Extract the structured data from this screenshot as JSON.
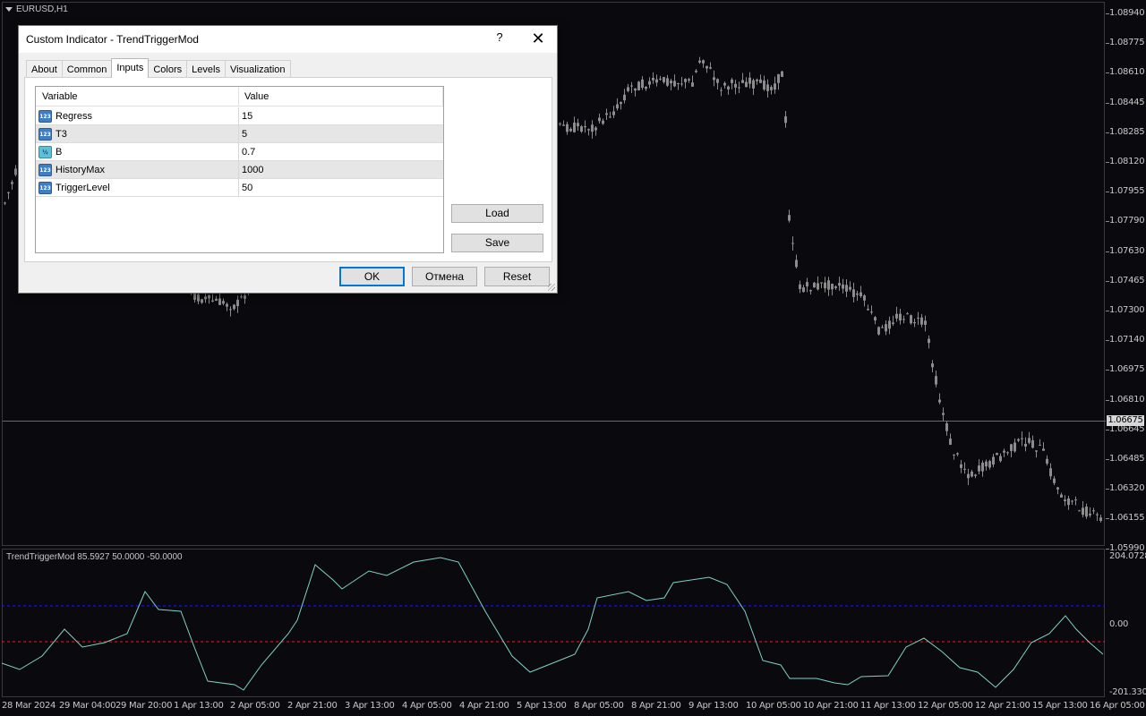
{
  "chart": {
    "symbol": "EURUSD,H1",
    "current_price": "1.06675",
    "price_labels": [
      "1.08940",
      "1.08775",
      "1.08610",
      "1.08445",
      "1.08285",
      "1.08120",
      "1.07955",
      "1.07790",
      "1.07630",
      "1.07465",
      "1.07300",
      "1.07140",
      "1.06975",
      "1.06810",
      "1.06645",
      "1.06485",
      "1.06320",
      "1.06155",
      "1.05990"
    ],
    "time_labels": [
      "28 Mar 2024",
      "29 Mar 04:00",
      "29 Mar 20:00",
      "1 Apr 13:00",
      "2 Apr 05:00",
      "2 Apr 21:00",
      "3 Apr 13:00",
      "4 Apr 05:00",
      "4 Apr 21:00",
      "5 Apr 13:00",
      "8 Apr 05:00",
      "8 Apr 21:00",
      "9 Apr 13:00",
      "10 Apr 05:00",
      "10 Apr 21:00",
      "11 Apr 13:00",
      "12 Apr 05:00",
      "12 Apr 21:00",
      "15 Apr 13:00",
      "16 Apr 05:00"
    ],
    "colors": {
      "background": "#0a0a0e",
      "candles": "#8c8c8c",
      "indicator_line": "#7fd1c8",
      "upper_level": "#1a1aff",
      "lower_level": "#e02020"
    }
  },
  "indicator": {
    "label": "TrendTriggerMod 85.5927 50.0000 -50.0000",
    "scale_top": "204.0728",
    "scale_mid": "0.00",
    "scale_bottom": "-201.3303"
  },
  "dialog": {
    "title": "Custom Indicator - TrendTriggerMod",
    "help_label": "?",
    "close_label": "✕",
    "tabs": [
      {
        "label": "About"
      },
      {
        "label": "Common"
      },
      {
        "label": "Inputs",
        "active": true
      },
      {
        "label": "Colors"
      },
      {
        "label": "Levels"
      },
      {
        "label": "Visualization"
      }
    ],
    "grid": {
      "col_variable": "Variable",
      "col_value": "Value",
      "rows": [
        {
          "icon": "integer-icon",
          "icon_text": "123",
          "name": "Regress",
          "value": "15"
        },
        {
          "icon": "integer-icon",
          "icon_text": "123",
          "name": "T3",
          "value": "5"
        },
        {
          "icon": "double-icon",
          "icon_text": "½",
          "name": "B",
          "value": "0.7"
        },
        {
          "icon": "integer-icon",
          "icon_text": "123",
          "name": "HistoryMax",
          "value": "1000"
        },
        {
          "icon": "integer-icon",
          "icon_text": "123",
          "name": "TriggerLevel",
          "value": "50"
        }
      ]
    },
    "load_label": "Load",
    "save_label": "Save",
    "ok_label": "OK",
    "cancel_label": "Отмена",
    "reset_label": "Reset"
  }
}
